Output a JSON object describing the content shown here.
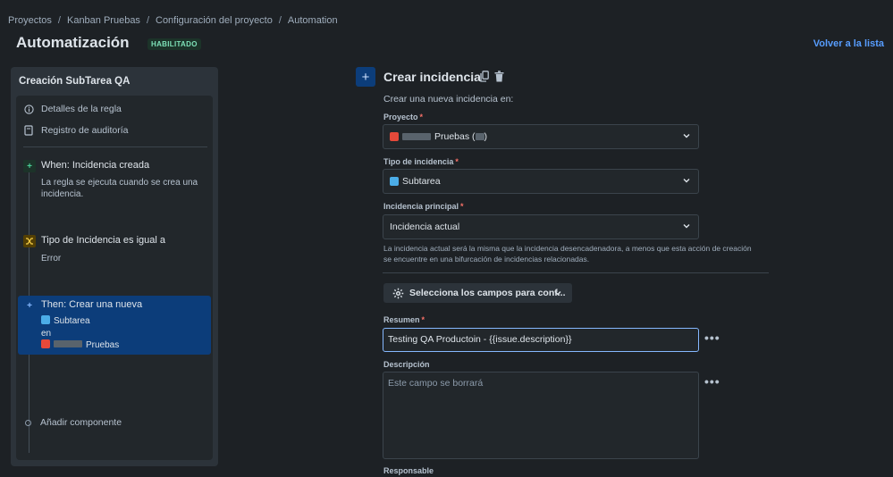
{
  "breadcrumb": [
    "Proyectos",
    "Kanban Pruebas",
    "Configuración del proyecto",
    "Automation"
  ],
  "header": {
    "title": "Automatización",
    "status_badge": "HABILITADO",
    "back_link": "Volver a la lista"
  },
  "rule": {
    "name": "Creación SubTarea QA",
    "menu": {
      "details": "Detalles de la regla",
      "audit": "Registro de auditoría"
    },
    "trigger": {
      "title": "When: Incidencia creada",
      "desc_line1": "La regla se ejecuta cuando se crea una",
      "desc_line2": "incidencia."
    },
    "condition": {
      "title": "Tipo de Incidencia es igual a",
      "value": "Error"
    },
    "action": {
      "title": "Then: Crear una nueva",
      "issue_type": "Subtarea",
      "connector": "en",
      "project": "Pruebas"
    },
    "add_component": "Añadir componente"
  },
  "editor": {
    "title": "Crear incidencia",
    "subtitle": "Crear una nueva incidencia en:",
    "project_label": "Proyecto",
    "project_value": "Pruebas (",
    "project_value_end": ")",
    "issue_type_label": "Tipo de incidencia",
    "issue_type_value": "Subtarea",
    "parent_label": "Incidencia principal",
    "parent_value": "Incidencia actual",
    "help_text": "La incidencia actual será la misma que la incidencia desencadenadora, a menos que esta acción de creación se encuentre en una bifurcación de incidencias relacionadas.",
    "fields_button": "Selecciona los campos para conf...",
    "summary_label": "Resumen",
    "summary_value": "Testing QA Productoin - {{issue.description}}",
    "description_label": "Descripción",
    "description_placeholder": "Este campo se borrará",
    "assignee_label": "Responsable",
    "required_mark": "*",
    "more_actions": "•••"
  },
  "colors": {
    "accent": "#579dff",
    "selected": "#0c3d7a",
    "badge_bg": "#1c3329",
    "badge_fg": "#7ee2b8"
  }
}
